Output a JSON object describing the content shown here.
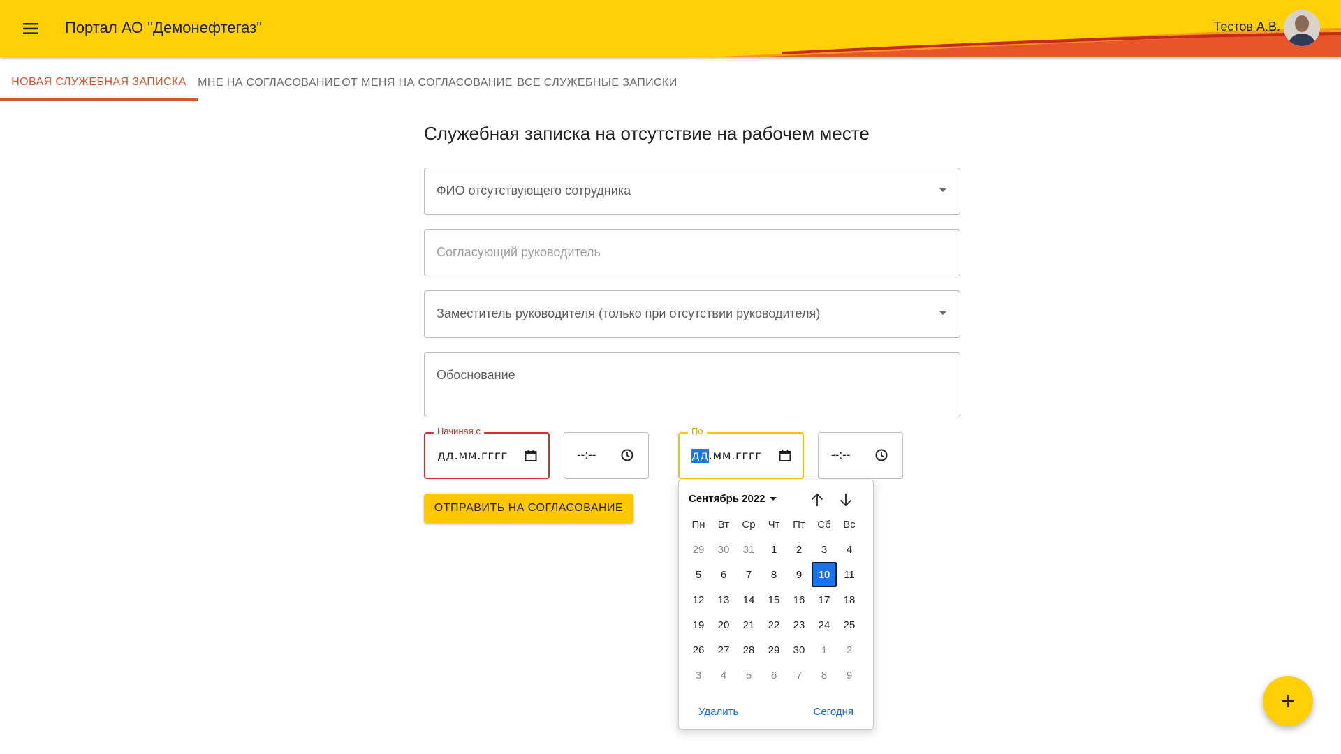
{
  "app": {
    "title": "Портал АО \"Демонефтегаз\"",
    "user_name": "Тестов А.В.",
    "brand_color": "#ffd008",
    "accent_color": "#d9532b"
  },
  "tabs": [
    {
      "label": "НОВАЯ СЛУЖЕБНАЯ ЗАПИСКА",
      "active": true
    },
    {
      "label": "МНЕ НА СОГЛАСОВАНИЕ",
      "active": false
    },
    {
      "label": "ОТ МЕНЯ НА СОГЛАСОВАНИЕ",
      "active": false
    },
    {
      "label": "ВСЕ СЛУЖЕБНЫЕ ЗАПИСКИ",
      "active": false
    }
  ],
  "form": {
    "title": "Служебная записка на отсутствие на рабочем месте",
    "employee_placeholder": "ФИО отсутствующего сотрудника",
    "manager_placeholder": "Согласующий руководитель",
    "deputy_placeholder": "Заместитель руководителя (только при отсутствии руководителя)",
    "reason_placeholder": "Обоснование",
    "start_label": "Начиная с",
    "end_label": "По",
    "date_mask_day": "дд",
    "date_mask_rest": ".мм.гггг",
    "time_mask": "--:--",
    "submit_label": "ОТПРАВИТЬ НА СОГЛАСОВАНИЕ"
  },
  "calendar": {
    "month_label": "Сентябрь 2022",
    "weekdays": [
      "Пн",
      "Вт",
      "Ср",
      "Чт",
      "Пт",
      "Сб",
      "Вс"
    ],
    "days": [
      {
        "n": "29",
        "out": true
      },
      {
        "n": "30",
        "out": true
      },
      {
        "n": "31",
        "out": true
      },
      {
        "n": "1"
      },
      {
        "n": "2"
      },
      {
        "n": "3"
      },
      {
        "n": "4"
      },
      {
        "n": "5"
      },
      {
        "n": "6"
      },
      {
        "n": "7"
      },
      {
        "n": "8"
      },
      {
        "n": "9"
      },
      {
        "n": "10",
        "selected": true
      },
      {
        "n": "11"
      },
      {
        "n": "12"
      },
      {
        "n": "13"
      },
      {
        "n": "14"
      },
      {
        "n": "15"
      },
      {
        "n": "16"
      },
      {
        "n": "17"
      },
      {
        "n": "18"
      },
      {
        "n": "19"
      },
      {
        "n": "20"
      },
      {
        "n": "21"
      },
      {
        "n": "22"
      },
      {
        "n": "23"
      },
      {
        "n": "24"
      },
      {
        "n": "25"
      },
      {
        "n": "26"
      },
      {
        "n": "27"
      },
      {
        "n": "28"
      },
      {
        "n": "29"
      },
      {
        "n": "30"
      },
      {
        "n": "1",
        "out": true
      },
      {
        "n": "2",
        "out": true
      },
      {
        "n": "3",
        "out": true
      },
      {
        "n": "4",
        "out": true
      },
      {
        "n": "5",
        "out": true
      },
      {
        "n": "6",
        "out": true
      },
      {
        "n": "7",
        "out": true
      },
      {
        "n": "8",
        "out": true
      },
      {
        "n": "9",
        "out": true
      }
    ],
    "clear_label": "Удалить",
    "today_label": "Сегодня"
  },
  "icons": {
    "menu": "menu-icon",
    "calendar": "calendar-icon",
    "clock": "clock-icon",
    "prev": "arrow-up-icon",
    "next": "arrow-down-icon",
    "fab": "plus-icon"
  }
}
